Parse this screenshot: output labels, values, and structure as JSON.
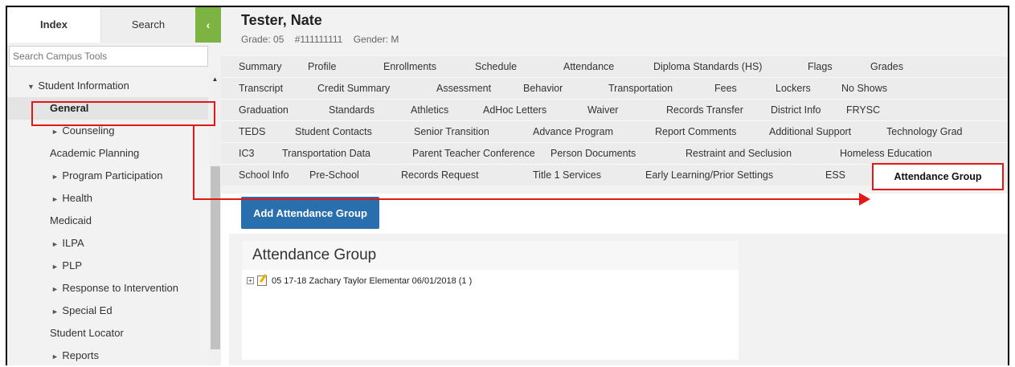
{
  "sidebar": {
    "tabs": {
      "index": "Index",
      "search": "Search"
    },
    "collapse_icon": "‹",
    "search_placeholder": "Search Campus Tools",
    "tree": [
      {
        "label": "Student Information",
        "expanded": true,
        "level": 0
      },
      {
        "label": "General",
        "selected": true,
        "level": 1
      },
      {
        "label": "Counseling",
        "collapsed": true,
        "level": 2
      },
      {
        "label": "Academic Planning",
        "level": 1
      },
      {
        "label": "Program Participation",
        "collapsed": true,
        "level": 2
      },
      {
        "label": "Health",
        "collapsed": true,
        "level": 2
      },
      {
        "label": "Medicaid",
        "level": 1
      },
      {
        "label": "ILPA",
        "collapsed": true,
        "level": 2
      },
      {
        "label": "PLP",
        "collapsed": true,
        "level": 2
      },
      {
        "label": "Response to Intervention",
        "collapsed": true,
        "level": 2
      },
      {
        "label": "Special Ed",
        "collapsed": true,
        "level": 2
      },
      {
        "label": "Student Locator",
        "level": 1
      },
      {
        "label": "Reports",
        "collapsed": true,
        "level": 2
      }
    ]
  },
  "student": {
    "name": "Tester, Nate",
    "grade": "Grade: 05",
    "id": "#111111111",
    "gender": "Gender: M"
  },
  "tabs": [
    [
      "Summary",
      "Profile",
      "Enrollments",
      "Schedule",
      "Attendance",
      "Diploma Standards (HS)",
      "Flags",
      "Grades"
    ],
    [
      "Transcript",
      "Credit Summary",
      "Assessment",
      "Behavior",
      "Transportation",
      "Fees",
      "Lockers",
      "No Shows"
    ],
    [
      "Graduation",
      "Standards",
      "Athletics",
      "AdHoc Letters",
      "Waiver",
      "Records Transfer",
      "District Info",
      "FRYSC"
    ],
    [
      "TEDS",
      "Student Contacts",
      "Senior Transition",
      "Advance Program",
      "Report Comments",
      "Additional Support",
      "Technology Grad"
    ],
    [
      "IC3",
      "Transportation Data",
      "Parent Teacher Conference",
      "Person Documents",
      "Restraint and Seclusion",
      "Homeless Education"
    ],
    [
      "School Info",
      "Pre-School",
      "Records Request",
      "Title 1 Services",
      "Early Learning/Prior Settings",
      "ESS",
      "Attendance Group"
    ]
  ],
  "active_tab": "Attendance Group",
  "content": {
    "add_button": "Add Attendance Group",
    "panel_title": "Attendance Group",
    "group_entry": "05 17-18 Zachary Taylor Elementar 06/01/2018 (1 )"
  },
  "colors": {
    "accent_green": "#7cb342",
    "button_blue": "#2a6fad",
    "highlight_red": "#e01818"
  }
}
